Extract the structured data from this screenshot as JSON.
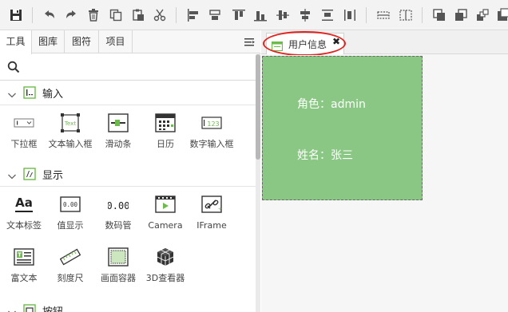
{
  "toolbar": {
    "buttons": [
      "save-icon",
      "undo-icon",
      "redo-icon",
      "delete-icon",
      "copy-icon",
      "paste-icon",
      "cut-icon",
      "align-left-icon",
      "align-center-icon",
      "align-top-icon",
      "align-bottom-icon",
      "align-middle-icon",
      "align-vertical-center-icon",
      "distribute-icon",
      "group-icon",
      "ungroup-icon",
      "bring-front-icon",
      "send-back-icon",
      "layer-up-icon",
      "layer-down-icon"
    ]
  },
  "left_panel": {
    "tabs": [
      "工具",
      "图库",
      "图符",
      "项目"
    ],
    "search": {
      "placeholder": ""
    },
    "sections": [
      {
        "label": "输入",
        "items": [
          "下拉框",
          "文本输入框",
          "滑动条",
          "日历",
          "数字输入框"
        ]
      },
      {
        "label": "显示",
        "items": [
          "文本标签",
          "值显示",
          "数码管",
          "Camera",
          "IFrame",
          "富文本",
          "刻度尺",
          "画面容器",
          "3D查看器"
        ]
      },
      {
        "label": "按钮",
        "items": []
      }
    ],
    "icon_text": {
      "text_input": "Text",
      "number_input": "123",
      "text_label": "Aa",
      "value_display": "0.00",
      "digital_tube": "0.00"
    }
  },
  "editor": {
    "tab_label": "用户信息",
    "tab_close": "✖",
    "card": {
      "role_line": "角色：admin",
      "name_line": "姓名：张三",
      "color": "#8bc784"
    }
  },
  "colors": {
    "accent_green": "#6dbb4a",
    "highlight_red": "#e0241f"
  }
}
